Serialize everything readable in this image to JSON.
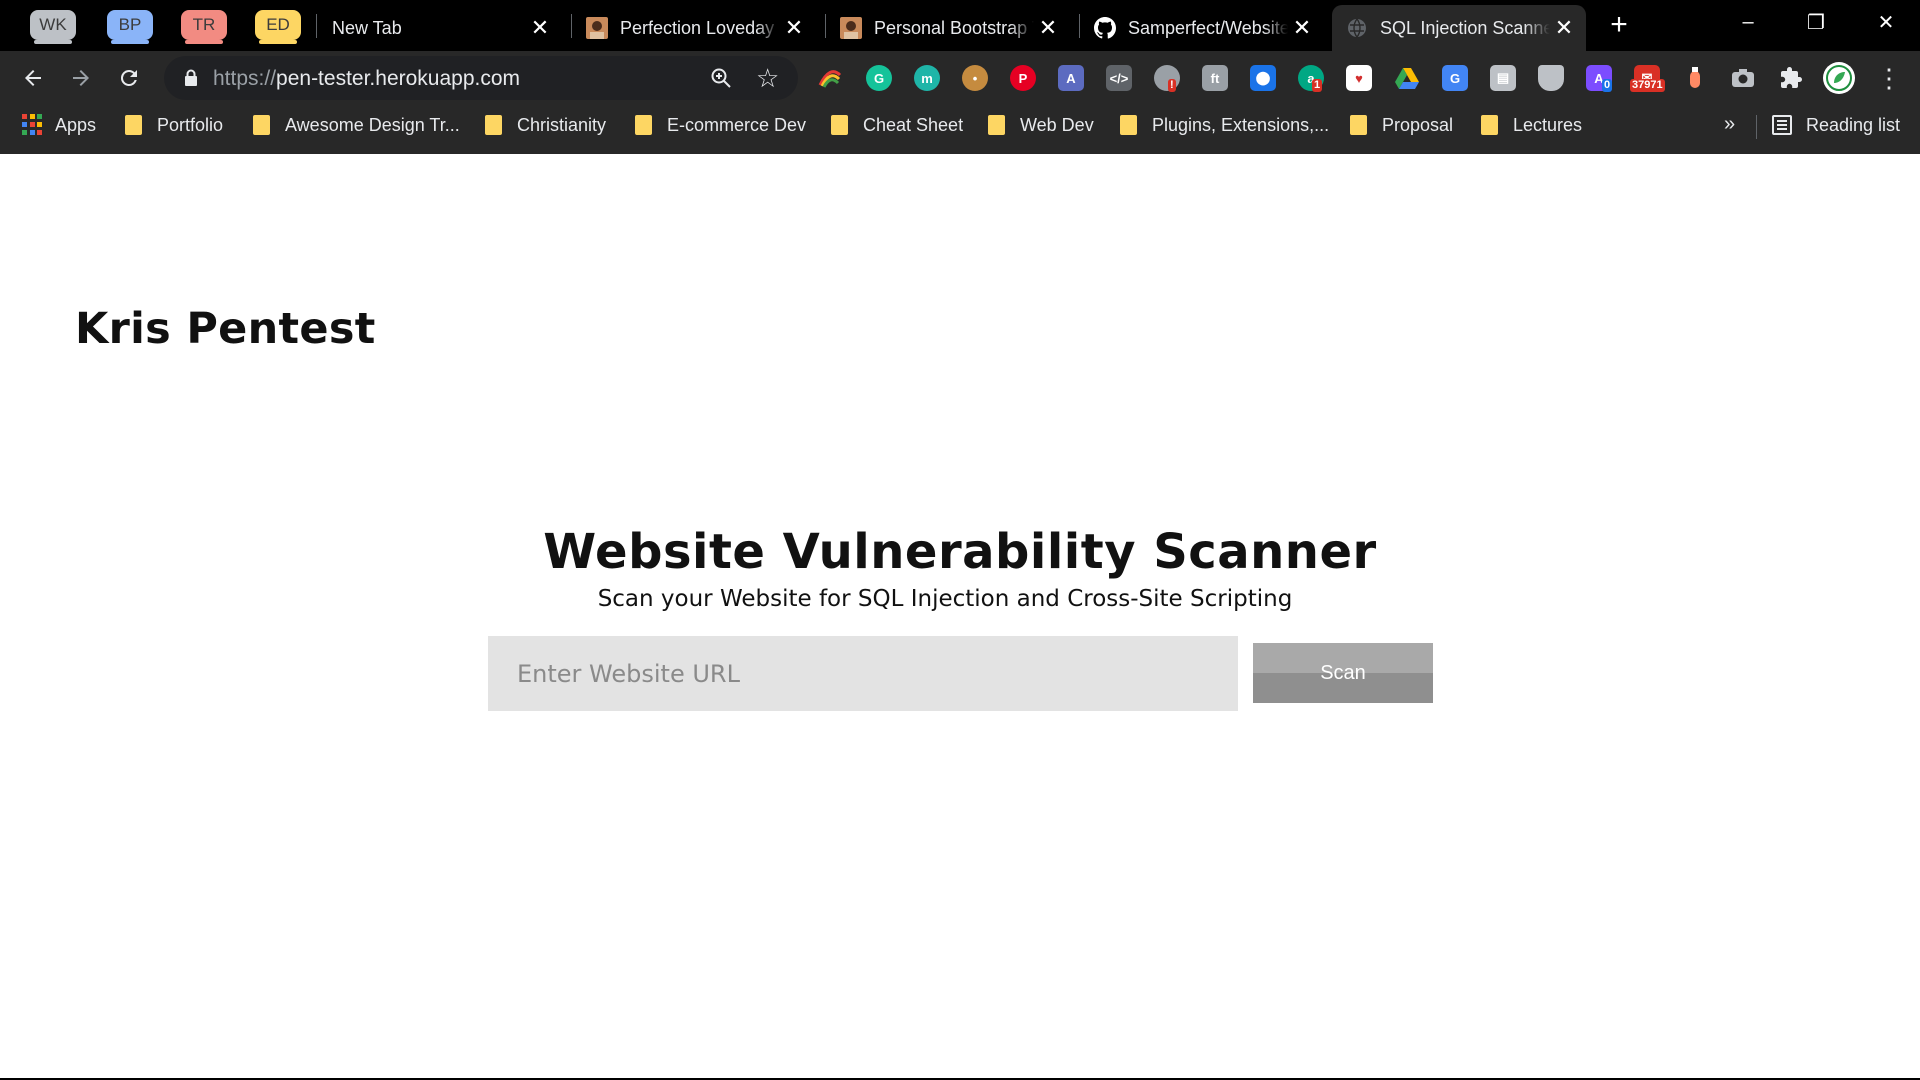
{
  "tab_groups": [
    {
      "label": "WK",
      "color": "#bdc1c6"
    },
    {
      "label": "BP",
      "color": "#8ab4f8"
    },
    {
      "label": "TR",
      "color": "#f28b82"
    },
    {
      "label": "ED",
      "color": "#fdd663"
    }
  ],
  "tabs": [
    {
      "title": "New Tab",
      "icon": "none"
    },
    {
      "title": "Perfection Loveday | Web Developer",
      "icon": "avatar-favicon"
    },
    {
      "title": "Personal Bootstrap Theme",
      "icon": "avatar-favicon"
    },
    {
      "title": "Samperfect/Website-Vulnerability-Scanner",
      "icon": "github-icon"
    },
    {
      "title": "SQL Injection Scanner",
      "icon": "globe-icon",
      "active": true
    }
  ],
  "window_controls": {
    "minimize": "–",
    "restore": "❐",
    "close": "✕"
  },
  "toolbar": {
    "url_scheme": "https://",
    "url_host": "pen-tester.herokuapp.com",
    "extension_badges": {
      "comments": "!",
      "grammar": "1",
      "notes": "0",
      "mail": "37971"
    }
  },
  "bookmarks": {
    "apps_label": "Apps",
    "folders": [
      "Portfolio",
      "Awesome Design Tr...",
      "Christianity",
      "E-commerce Dev",
      "Cheat Sheet",
      "Web Dev",
      "Plugins, Extensions,...",
      "Proposal",
      "Lectures"
    ],
    "more": "»",
    "reading_list": "Reading list"
  },
  "page": {
    "brand": "Kris Pentest",
    "heading": "Website Vulnerability Scanner",
    "subheading": "Scan your Website for SQL Injection and Cross-Site Scripting",
    "url_placeholder": "Enter Website URL",
    "scan_label": "Scan"
  }
}
